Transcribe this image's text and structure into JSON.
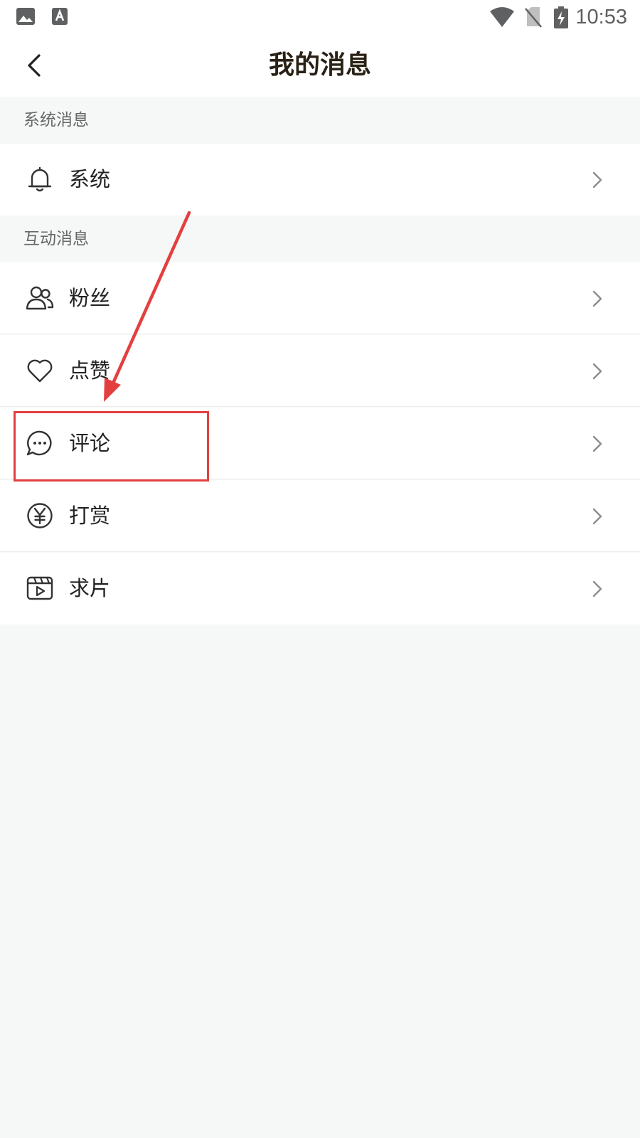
{
  "status_bar": {
    "time": "10:53",
    "left_icons": [
      "image-icon",
      "text-a-icon"
    ],
    "right_icons": [
      "wifi-icon",
      "no-sim-icon",
      "battery-charging-icon"
    ]
  },
  "header": {
    "title": "我的消息",
    "back_icon": "chevron-left-icon"
  },
  "sections": [
    {
      "title": "系统消息",
      "items": [
        {
          "label": "系统",
          "icon": "bell-icon"
        }
      ]
    },
    {
      "title": "互动消息",
      "items": [
        {
          "label": "粉丝",
          "icon": "users-icon"
        },
        {
          "label": "点赞",
          "icon": "heart-icon"
        },
        {
          "label": "评论",
          "icon": "comment-icon"
        },
        {
          "label": "打赏",
          "icon": "yen-coin-icon"
        },
        {
          "label": "求片",
          "icon": "video-request-icon"
        }
      ]
    }
  ],
  "colors": {
    "annotation": "#e2403f",
    "background": "#f6f7f7",
    "title": "#2a2116"
  }
}
